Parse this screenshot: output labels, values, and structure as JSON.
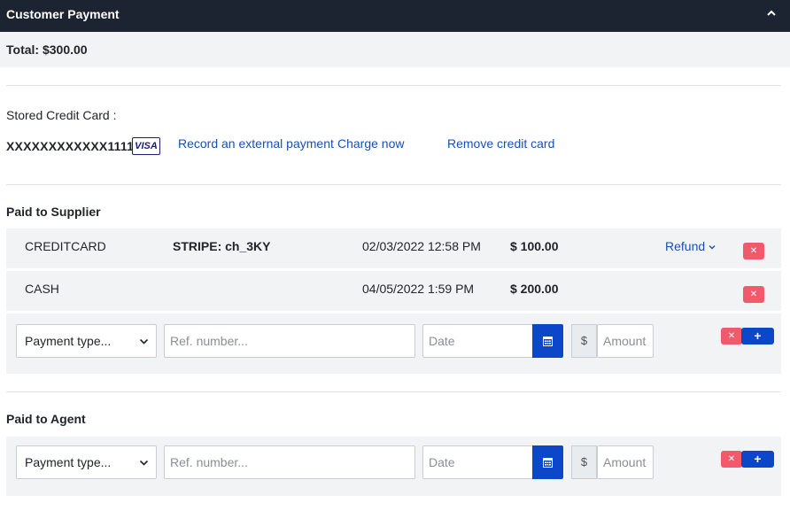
{
  "header": {
    "title": "Customer Payment"
  },
  "total": {
    "text": "Total: $300.00"
  },
  "stored_card": {
    "label": "Stored Credit Card :",
    "number": "XXXXXXXXXXXX1111",
    "brand": "VISA",
    "record_external_label": "Record an external payment",
    "charge_now_label": "Charge now",
    "remove_label": "Remove credit card"
  },
  "supplier": {
    "title": "Paid to Supplier",
    "payments": [
      {
        "type": "CREDITCARD",
        "ref": "STRIPE: ch_3KY",
        "date": "02/03/2022 12:58 PM",
        "amount": "$ 100.00",
        "refund_label": "Refund"
      },
      {
        "type": "CASH",
        "ref": "",
        "date": "04/05/2022 1:59 PM",
        "amount": "$ 200.00"
      }
    ],
    "new_payment": {
      "type_value": "Payment type...",
      "ref_placeholder": "Ref. number...",
      "date_placeholder": "Date",
      "currency": "$",
      "amount_placeholder": "Amount"
    }
  },
  "agent": {
    "title": "Paid to Agent",
    "new_payment": {
      "type_value": "Payment type...",
      "ref_placeholder": "Ref. number...",
      "date_placeholder": "Date",
      "currency": "$",
      "amount_placeholder": "Amount"
    }
  },
  "buttons": {
    "delete_glyph": "✕",
    "add_glyph": "+"
  },
  "colors": {
    "header_bg": "#1c2431",
    "link": "#1a4fb5",
    "primary": "#0d47c9",
    "danger": "#f15a6b",
    "panel_bg": "#f2f3f5"
  }
}
